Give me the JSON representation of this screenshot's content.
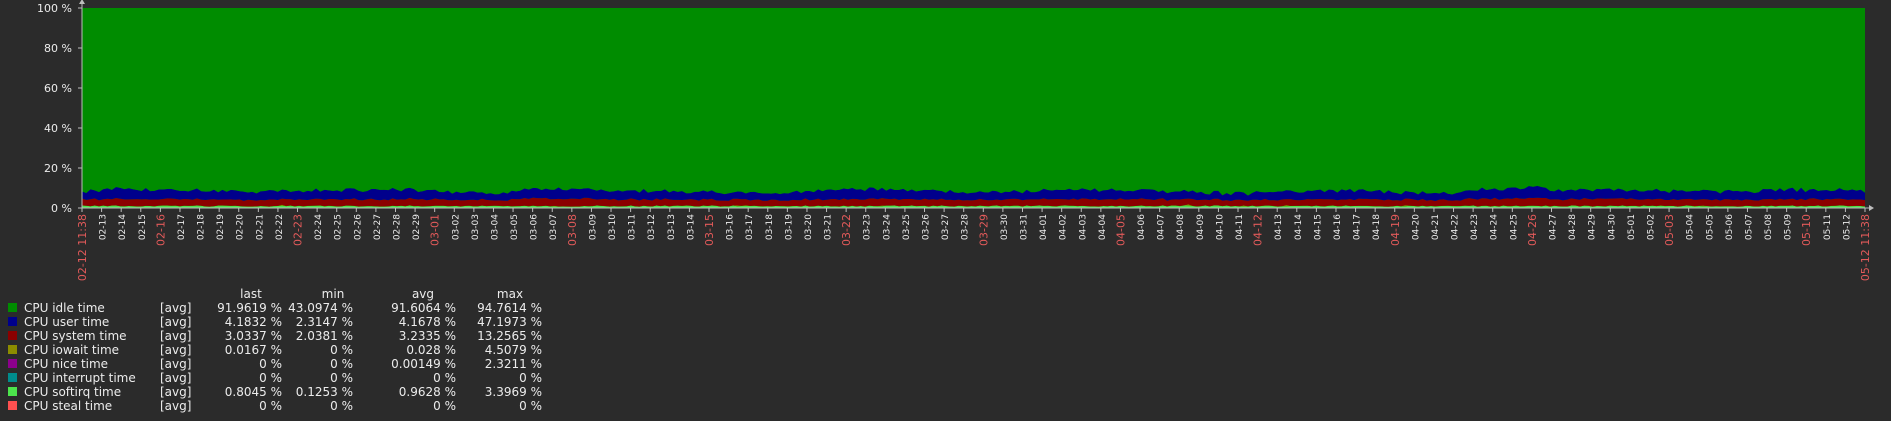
{
  "chart_data": {
    "type": "area",
    "stacked": true,
    "ylim": [
      0,
      100
    ],
    "y_ticks": [
      "100 %",
      "80 %",
      "60 %",
      "40 %",
      "20 %",
      "0 %"
    ],
    "y_tick_values": [
      100,
      80,
      60,
      40,
      20,
      0
    ],
    "grid": false,
    "legend_placement": "bottom-left",
    "x_ticks": [
      {
        "label": "02-12 11:38",
        "red": true
      },
      {
        "label": "02-13"
      },
      {
        "label": "02-14"
      },
      {
        "label": "02-15"
      },
      {
        "label": "02-16",
        "red": true
      },
      {
        "label": "02-17"
      },
      {
        "label": "02-18"
      },
      {
        "label": "02-19"
      },
      {
        "label": "02-20"
      },
      {
        "label": "02-21"
      },
      {
        "label": "02-22"
      },
      {
        "label": "02-23",
        "red": true
      },
      {
        "label": "02-24"
      },
      {
        "label": "02-25"
      },
      {
        "label": "02-26"
      },
      {
        "label": "02-27"
      },
      {
        "label": "02-28"
      },
      {
        "label": "02-29"
      },
      {
        "label": "03-01",
        "red": true
      },
      {
        "label": "03-02"
      },
      {
        "label": "03-03"
      },
      {
        "label": "03-04"
      },
      {
        "label": "03-05"
      },
      {
        "label": "03-06"
      },
      {
        "label": "03-07"
      },
      {
        "label": "03-08",
        "red": true
      },
      {
        "label": "03-09"
      },
      {
        "label": "03-10"
      },
      {
        "label": "03-11"
      },
      {
        "label": "03-12"
      },
      {
        "label": "03-13"
      },
      {
        "label": "03-14"
      },
      {
        "label": "03-15",
        "red": true
      },
      {
        "label": "03-16"
      },
      {
        "label": "03-17"
      },
      {
        "label": "03-18"
      },
      {
        "label": "03-19"
      },
      {
        "label": "03-20"
      },
      {
        "label": "03-21"
      },
      {
        "label": "03-22",
        "red": true
      },
      {
        "label": "03-23"
      },
      {
        "label": "03-24"
      },
      {
        "label": "03-25"
      },
      {
        "label": "03-26"
      },
      {
        "label": "03-27"
      },
      {
        "label": "03-28"
      },
      {
        "label": "03-29",
        "red": true
      },
      {
        "label": "03-30"
      },
      {
        "label": "03-31"
      },
      {
        "label": "04-01"
      },
      {
        "label": "04-02"
      },
      {
        "label": "04-03"
      },
      {
        "label": "04-04"
      },
      {
        "label": "04-05",
        "red": true
      },
      {
        "label": "04-06"
      },
      {
        "label": "04-07"
      },
      {
        "label": "04-08"
      },
      {
        "label": "04-09"
      },
      {
        "label": "04-10"
      },
      {
        "label": "04-11"
      },
      {
        "label": "04-12",
        "red": true
      },
      {
        "label": "04-13"
      },
      {
        "label": "04-14"
      },
      {
        "label": "04-15"
      },
      {
        "label": "04-16"
      },
      {
        "label": "04-17"
      },
      {
        "label": "04-18"
      },
      {
        "label": "04-19",
        "red": true
      },
      {
        "label": "04-20"
      },
      {
        "label": "04-21"
      },
      {
        "label": "04-22"
      },
      {
        "label": "04-23"
      },
      {
        "label": "04-24"
      },
      {
        "label": "04-25"
      },
      {
        "label": "04-26",
        "red": true
      },
      {
        "label": "04-27"
      },
      {
        "label": "04-28"
      },
      {
        "label": "04-29"
      },
      {
        "label": "04-30"
      },
      {
        "label": "05-01"
      },
      {
        "label": "05-02"
      },
      {
        "label": "05-03",
        "red": true
      },
      {
        "label": "05-04"
      },
      {
        "label": "05-05"
      },
      {
        "label": "05-06"
      },
      {
        "label": "05-07"
      },
      {
        "label": "05-08"
      },
      {
        "label": "05-09"
      },
      {
        "label": "05-10",
        "red": true
      },
      {
        "label": "05-11"
      },
      {
        "label": "05-12"
      },
      {
        "label": "05-12 11:38",
        "red": true
      }
    ],
    "series": [
      {
        "name": "CPU idle time",
        "color": "#008c00",
        "fn": "[avg]",
        "last": "91.9619 %",
        "min": "43.0974 %",
        "avg": "91.6064 %",
        "max": "94.7614 %",
        "mean": 91.6064
      },
      {
        "name": "CPU user time",
        "color": "#00008c",
        "fn": "[avg]",
        "last": "4.1832 %",
        "min": "2.3147 %",
        "avg": "4.1678 %",
        "max": "47.1973 %",
        "mean": 4.1678
      },
      {
        "name": "CPU system time",
        "color": "#8c0000",
        "fn": "[avg]",
        "last": "3.0337 %",
        "min": "2.0381 %",
        "avg": "3.2335 %",
        "max": "13.2565 %",
        "mean": 3.2335
      },
      {
        "name": "CPU iowait time",
        "color": "#8c8c00",
        "fn": "[avg]",
        "last": "0.0167 %",
        "min": "0 %",
        "avg": "0.028 %",
        "max": "4.5079 %",
        "mean": 0.028
      },
      {
        "name": "CPU nice time",
        "color": "#8c008c",
        "fn": "[avg]",
        "last": "0 %",
        "min": "0 %",
        "avg": "0.00149 %",
        "max": "2.3211 %",
        "mean": 0.00149
      },
      {
        "name": "CPU interrupt time",
        "color": "#008c8c",
        "fn": "[avg]",
        "last": "0 %",
        "min": "0 %",
        "avg": "0 %",
        "max": "0 %",
        "mean": 0
      },
      {
        "name": "CPU softirq time",
        "color": "#4ce44c",
        "fn": "[avg]",
        "last": "0.8045 %",
        "min": "0.1253 %",
        "avg": "0.9628 %",
        "max": "3.3969 %",
        "mean": 0.9628
      },
      {
        "name": "CPU steal time",
        "color": "#ff5050",
        "fn": "[avg]",
        "last": "0 %",
        "min": "0 %",
        "avg": "0 %",
        "max": "0 %",
        "mean": 0
      }
    ]
  },
  "legend": {
    "col_last": "last",
    "col_min": "min",
    "col_avg": "avg",
    "col_max": "max"
  },
  "colors": {
    "background": "#2b2b2b",
    "plot_background": "#008c00",
    "axis": "#bdbdbd",
    "text": "#ececec",
    "highlight_text": "#e25a5a"
  }
}
